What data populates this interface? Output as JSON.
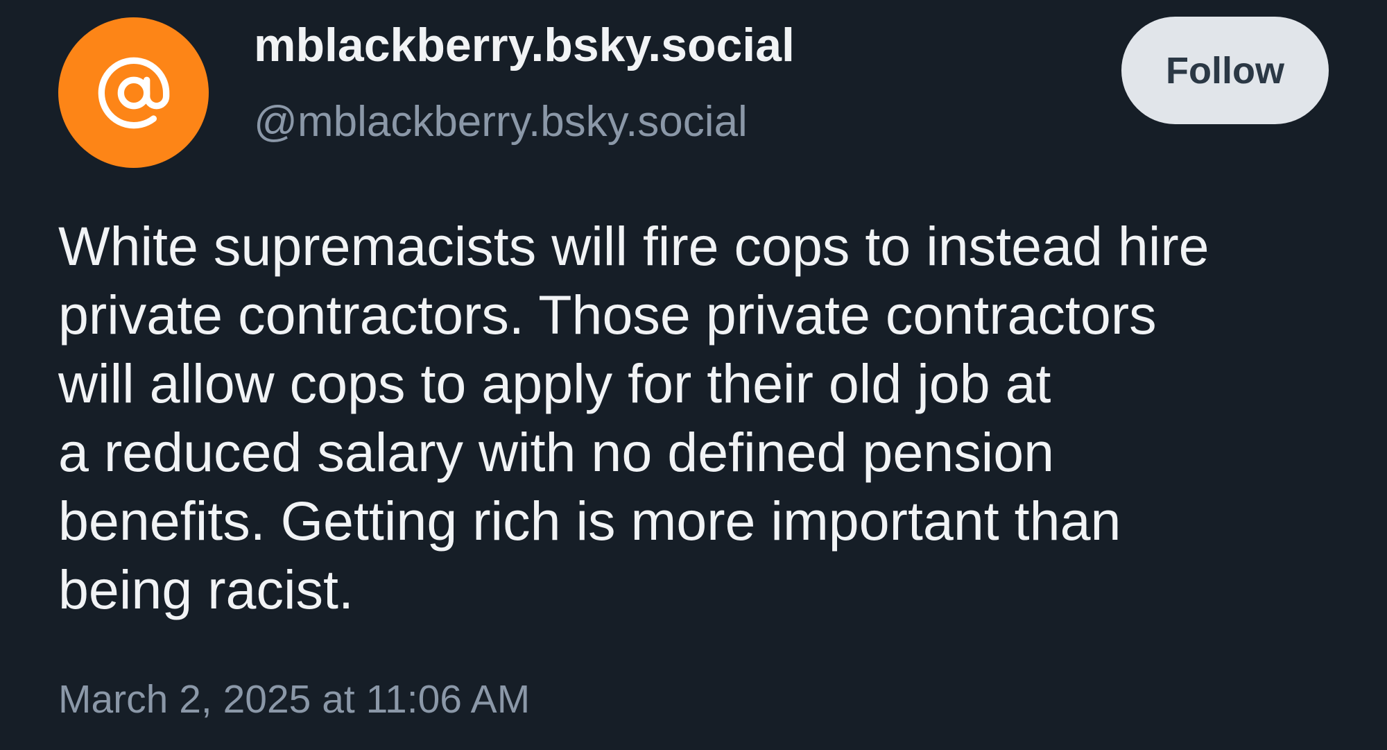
{
  "author": {
    "display_name": "mblackberry.bsky.social",
    "handle": "@mblackberry.bsky.social",
    "avatar_icon": "at-sign-icon"
  },
  "follow_button": {
    "label": "Follow"
  },
  "post": {
    "text_lines": [
      "White supremacists will fire cops to instead hire",
      "private contractors. Those private contractors",
      "will allow cops to apply for their old job at",
      "a reduced salary with no defined pension",
      "benefits. Getting rich is more important than",
      "being racist."
    ],
    "timestamp": "March 2, 2025 at 11:06 AM"
  },
  "colors": {
    "background": "#161e27",
    "avatar_orange": "#fd8517",
    "text_primary": "#f1f3f5",
    "text_secondary": "#8b98a8",
    "button_bg": "#e1e5ea",
    "button_text": "#2b3845"
  }
}
